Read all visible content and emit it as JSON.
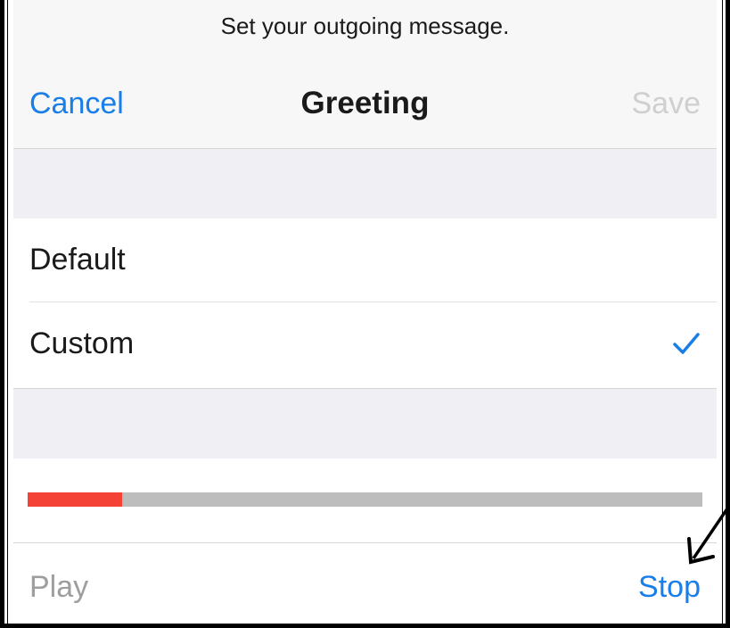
{
  "header": {
    "prompt": "Set your outgoing message.",
    "cancel_label": "Cancel",
    "title": "Greeting",
    "save_label": "Save"
  },
  "options": [
    {
      "label": "Default",
      "selected": false
    },
    {
      "label": "Custom",
      "selected": true
    }
  ],
  "player": {
    "progress_fraction": 0.14,
    "play_label": "Play",
    "stop_label": "Stop"
  },
  "icons": {
    "check": "checkmark-icon",
    "annotation": "arrow-icon"
  },
  "colors": {
    "accent": "#1a7ee8",
    "disabled": "#cfcfcf",
    "progress": "#f44336",
    "track": "#bdbdbd"
  }
}
